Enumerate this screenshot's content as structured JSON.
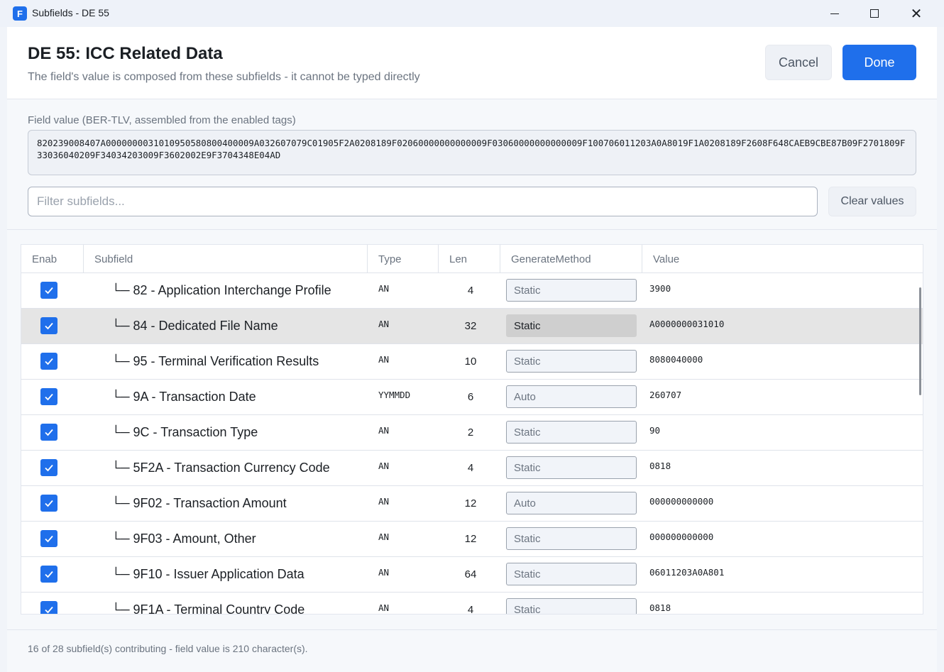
{
  "window": {
    "title": "Subfields - DE 55",
    "app_icon_letter": "F"
  },
  "header": {
    "title": "DE 55: ICC Related Data",
    "subtitle": "The field's value is composed from these subfields - it cannot be typed directly",
    "cancel_label": "Cancel",
    "done_label": "Done"
  },
  "field_value": {
    "label": "Field value (BER-TLV, assembled from the enabled tags)",
    "value": "820239008407A0000000031010950580800400009A032607079C01905F2A0208189F02060000000000009F03060000000000009F100706011203A0A8019F1A0208189F2608F648CAEB9CBE87B09F2701809F33036040209F34034203009F3602002E9F3704348E04AD"
  },
  "filter": {
    "placeholder": "Filter subfields...",
    "clear_label": "Clear values"
  },
  "grid": {
    "columns": {
      "enabled": "Enab",
      "subfield": "Subfield",
      "type": "Type",
      "len": "Len",
      "generate_method": "GenerateMethod",
      "value": "Value"
    },
    "rows": [
      {
        "subfield": "└─ 82 - Application Interchange Profile",
        "type": "AN",
        "len": "4",
        "generate_method": "Static",
        "value": "3900",
        "enabled": true
      },
      {
        "subfield": "└─ 84 - Dedicated File Name",
        "type": "AN",
        "len": "32",
        "generate_method": "Static",
        "value": "A0000000031010",
        "enabled": true,
        "selected": true
      },
      {
        "subfield": "└─ 95 - Terminal Verification Results",
        "type": "AN",
        "len": "10",
        "generate_method": "Static",
        "value": "8080040000",
        "enabled": true
      },
      {
        "subfield": "└─ 9A - Transaction Date",
        "type": "YYMMDD",
        "len": "6",
        "generate_method": "Auto",
        "value": "260707",
        "enabled": true
      },
      {
        "subfield": "└─ 9C - Transaction Type",
        "type": "AN",
        "len": "2",
        "generate_method": "Static",
        "value": "90",
        "enabled": true
      },
      {
        "subfield": "└─ 5F2A - Transaction Currency Code",
        "type": "AN",
        "len": "4",
        "generate_method": "Static",
        "value": "0818",
        "enabled": true
      },
      {
        "subfield": "└─ 9F02 - Transaction Amount",
        "type": "AN",
        "len": "12",
        "generate_method": "Auto",
        "value": "000000000000",
        "enabled": true
      },
      {
        "subfield": "└─ 9F03 - Amount, Other",
        "type": "AN",
        "len": "12",
        "generate_method": "Static",
        "value": "000000000000",
        "enabled": true
      },
      {
        "subfield": "└─ 9F10 - Issuer Application Data",
        "type": "AN",
        "len": "64",
        "generate_method": "Static",
        "value": "06011203A0A801",
        "enabled": true
      },
      {
        "subfield": "└─ 9F1A - Terminal Country Code",
        "type": "AN",
        "len": "4",
        "generate_method": "Static",
        "value": "0818",
        "enabled": true
      }
    ]
  },
  "footer": {
    "status": "16 of 28 subfield(s) contributing - field value is 210 character(s)."
  },
  "colors": {
    "accent": "#1f6feb",
    "selected_row": "#e5e5e5"
  }
}
